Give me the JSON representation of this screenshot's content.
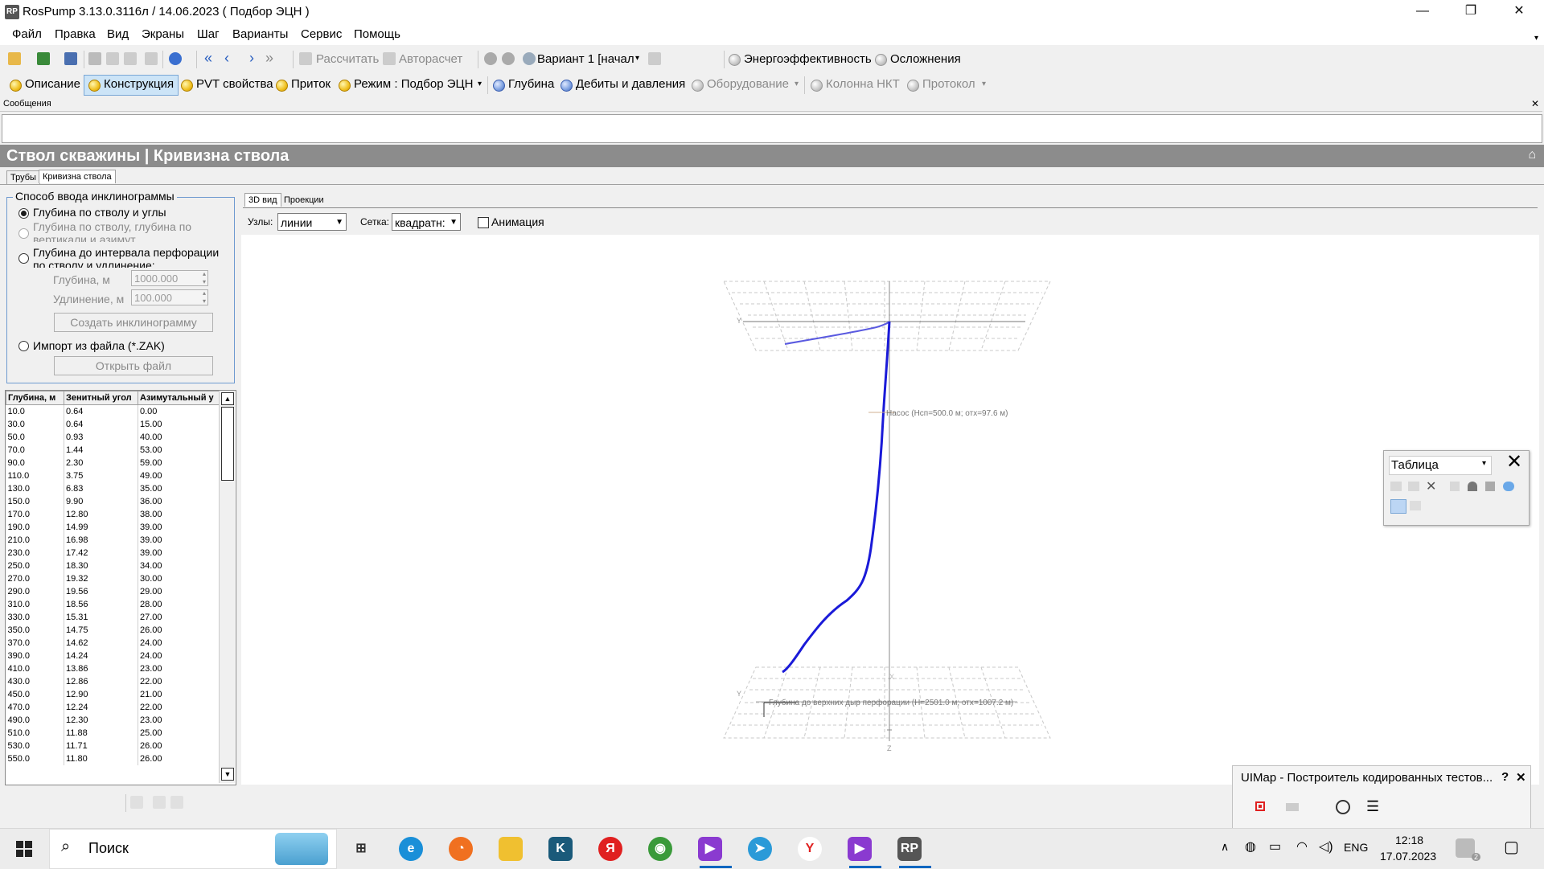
{
  "window": {
    "title": "RosPump 3.13.0.3116л / 14.06.2023 ( Подбор ЭЦН )",
    "app_icon": "RP",
    "controls": [
      "—",
      "❐",
      "✕"
    ]
  },
  "menu": [
    "Файл",
    "Правка",
    "Вид",
    "Экраны",
    "Шаг",
    "Варианты",
    "Сервис",
    "Помощь"
  ],
  "toolbar1": {
    "calculate": "Рассчитать",
    "autocalc": "Авторасчет",
    "variant": "Вариант 1 [начал",
    "energy": "Энергоэффективность",
    "complications": "Осложнения"
  },
  "toolbar2": {
    "items": [
      {
        "label": "Описание",
        "color": "y"
      },
      {
        "label": "Конструкция",
        "color": "y",
        "active": true
      },
      {
        "label": "PVT свойства",
        "color": "y"
      },
      {
        "label": "Приток",
        "color": "y"
      },
      {
        "label": "Режим : Подбор ЭЦН",
        "color": "y"
      },
      {
        "label": "Глубина",
        "color": "b"
      },
      {
        "label": "Дебиты и давления",
        "color": "b"
      },
      {
        "label": "Оборудование",
        "color": "g"
      },
      {
        "label": "Колонна НКТ",
        "color": "g"
      },
      {
        "label": "Протокол",
        "color": "g"
      }
    ]
  },
  "messages": {
    "header": "Сообщения"
  },
  "section": {
    "title": "Ствол скважины | Кривизна ствола"
  },
  "tabs": [
    "Трубы",
    "Кривизна ствола"
  ],
  "input_method": {
    "title": "Способ ввода инклинограммы",
    "opt1": "Глубина по стволу и углы",
    "opt2a": "Глубина по стволу, глубина по",
    "opt2b": "вертикали и азимут",
    "opt3a": "Глубина до интервала перфорации",
    "opt3b": "по стволу и удлинение:",
    "depth_label": "Глубина, м",
    "depth_value": "1000.000",
    "elong_label": "Удлинение, м",
    "elong_value": "100.000",
    "create_btn": "Создать инклинограмму",
    "opt4": "Импорт из файла (*.ZAK)",
    "open_btn": "Открыть файл"
  },
  "grid": {
    "columns": [
      "Глубина, м",
      "Зенитный угол",
      "Азимутальный у"
    ],
    "rows": [
      [
        "10.0",
        "0.64",
        "0.00"
      ],
      [
        "30.0",
        "0.64",
        "15.00"
      ],
      [
        "50.0",
        "0.93",
        "40.00"
      ],
      [
        "70.0",
        "1.44",
        "53.00"
      ],
      [
        "90.0",
        "2.30",
        "59.00"
      ],
      [
        "110.0",
        "3.75",
        "49.00"
      ],
      [
        "130.0",
        "6.83",
        "35.00"
      ],
      [
        "150.0",
        "9.90",
        "36.00"
      ],
      [
        "170.0",
        "12.80",
        "38.00"
      ],
      [
        "190.0",
        "14.99",
        "39.00"
      ],
      [
        "210.0",
        "16.98",
        "39.00"
      ],
      [
        "230.0",
        "17.42",
        "39.00"
      ],
      [
        "250.0",
        "18.30",
        "34.00"
      ],
      [
        "270.0",
        "19.32",
        "30.00"
      ],
      [
        "290.0",
        "19.56",
        "29.00"
      ],
      [
        "310.0",
        "18.56",
        "28.00"
      ],
      [
        "330.0",
        "15.31",
        "27.00"
      ],
      [
        "350.0",
        "14.75",
        "26.00"
      ],
      [
        "370.0",
        "14.62",
        "24.00"
      ],
      [
        "390.0",
        "14.24",
        "24.00"
      ],
      [
        "410.0",
        "13.86",
        "23.00"
      ],
      [
        "430.0",
        "12.86",
        "22.00"
      ],
      [
        "450.0",
        "12.90",
        "21.00"
      ],
      [
        "470.0",
        "12.24",
        "22.00"
      ],
      [
        "490.0",
        "12.30",
        "23.00"
      ],
      [
        "510.0",
        "11.88",
        "25.00"
      ],
      [
        "530.0",
        "11.71",
        "26.00"
      ],
      [
        "550.0",
        "11.80",
        "26.00"
      ]
    ]
  },
  "view_tabs": [
    "3D вид",
    "Проекции"
  ],
  "view_controls": {
    "nodes_label": "Узлы:",
    "nodes_value": "линии",
    "grid_label": "Сетка:",
    "grid_value": "квадратн:",
    "animation_label": "Анимация"
  },
  "plot": {
    "pump_label": "Насос (Нсп=500.0 м; отх=97.6 м)",
    "perf_label": "Глубина до верхних дыр перфорации (Н=2501.0 м; отх=1007.2 м)",
    "axis_y": "Y",
    "axis_x": "X",
    "axis_z": "Z",
    "trajectory_color": "#1a1ad8"
  },
  "table_window": {
    "title": "Таблица"
  },
  "uimap": {
    "title": "UIMap - Построитель кодированных тестов...",
    "help": "?",
    "close": "✕"
  },
  "taskbar": {
    "search": "Поиск",
    "lang": "ENG",
    "time": "12:18",
    "date": "17.07.2023",
    "notif": "2"
  },
  "colors": {
    "section_bar": "#8c8c8c",
    "group_border": "#6e9ad0"
  }
}
